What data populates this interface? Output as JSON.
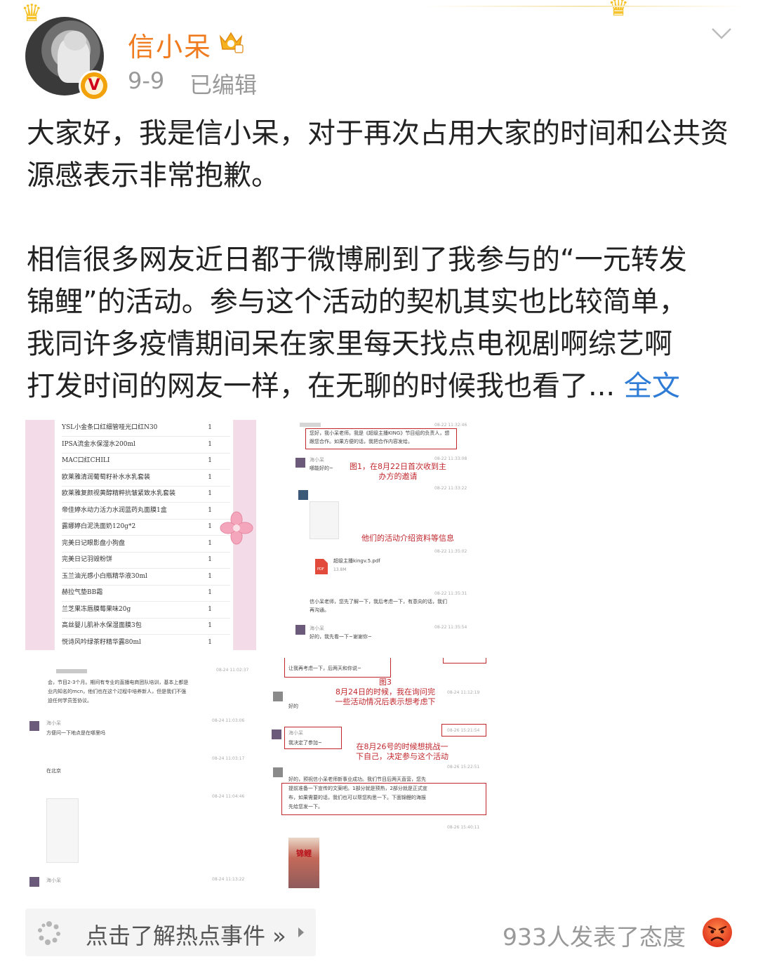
{
  "header": {
    "username": "信小呆",
    "date": "9-9",
    "edited": "已编辑",
    "verified_badge": "V",
    "icons": [
      "crown-icon",
      "vip-crown-icon",
      "verified-badge-icon",
      "chevron-down-icon"
    ]
  },
  "post": {
    "para1": "大家好，我是信小呆，对于再次占用大家的时间和公共资源感表示非常抱歉。",
    "para2_line1": "相信很多网友近日都于微博刷到了我参与的“一元转发",
    "para2_line2": "锦鲤”的活动。参与这个活动的契机其实也比较简单，",
    "para2_line3": "我同许多疫情期间呆在家里每天找点电视剧啊综艺啊",
    "para2_line4": "打发时间的网友一样，在无聊的时候我也看了...",
    "full_text_link": "全文"
  },
  "images": {
    "pic1_rows": [
      {
        "name": "YSL小金条口红细管哑光口红N30",
        "qty": "1"
      },
      {
        "name": "IPSA流金水保湿水200ml",
        "qty": "1"
      },
      {
        "name": "MAC口红CHILI",
        "qty": "1"
      },
      {
        "name": "欧莱雅清润葡萄籽补水水乳套装",
        "qty": "1"
      },
      {
        "name": "欧莱雅复颜视黄醇精粹抗皱紧致水乳套装",
        "qty": "1"
      },
      {
        "name": "帝佳婷水动力活力水润蓝药丸面膜1盒",
        "qty": "1"
      },
      {
        "name": "露娜婷白泥洗面奶120g*2",
        "qty": "1"
      },
      {
        "name": "完美日记眼影盘小狗盘",
        "qty": "1"
      },
      {
        "name": "完美日记羽毁粉饼",
        "qty": "1"
      },
      {
        "name": "玉兰油光感小白瓶精华液30ml",
        "qty": "1"
      },
      {
        "name": "赫拉气垫BB霜",
        "qty": "1"
      },
      {
        "name": "兰芝果冻唇膜莓果味20g",
        "qty": "1"
      },
      {
        "name": "高丝婴儿肌补水保湿面膜3包",
        "qty": "1"
      },
      {
        "name": "悦诗风吟绿茶籽精华露80ml",
        "qty": "1"
      }
    ],
    "pic2": {
      "msg1": "您好，我小呆老师。我是《超级主播KING》节目组的负责人，想",
      "msg1b": "跟您合作。如果方便的话，我把合作内容发给。",
      "sender": "海小呆",
      "reply1": "哪能好的~",
      "note1_line1": "图1，在8月22日首次收到主",
      "note1_line2": "办方的邀请",
      "note2": "他们的活动介绍资料等信息",
      "file_name": "超级主播kingv.5.pdf",
      "file_size": "13.8M",
      "msg2": "信小呆老师，您先了解一下，我后考虑一下，有意向的话，我们",
      "msg2b": "再沟通。",
      "reply2": "好的，我先看一下~谢谢你~",
      "time1": "08-22 11:32:46",
      "time2": "08-22 11:33:08",
      "time3": "08-22 11:33:22",
      "time4": "08-22 11:35:02",
      "time5": "08-22 11:35:31",
      "time6": "08-22 11:35:54"
    },
    "pic3": {
      "msg1": "会，节目2-3个月。期间有专业的直播电商团队培训，基本上都是",
      "msg1b": "业内知名的mcn，他们也在这个过程中培养新人，但是我们不强",
      "msg1c": "迫任何学员签协议。",
      "sender": "海小呆",
      "q1": "方便问一下地点是在哪里吗",
      "a1": "在北京",
      "time1": "08-24 11:02:37",
      "time2": "08-24 11:03:06",
      "time3": "08-24 11:03:17",
      "time4": "08-24 11:04:46",
      "time5": "08-24 11:13:22"
    },
    "pic4": {
      "top_msg": "让我再考虑一下，后两天和你说~",
      "note3_title": "图3",
      "note3_line1": "8月24日的时候，我在询问完",
      "note3_line2": "一些活动情况后表示想考虑下",
      "ok": "好的",
      "sender": "海小呆",
      "decide": "我决定了参加~",
      "note4_line1": "在8月26号的时候想挑战一",
      "note4_line2": "下自己，决定参与这个活动",
      "long1": "好的，预祝信小呆老师新事业成功。我们节目后两天直营，您先",
      "long2": "提前准备一下宣传的文案吧。1部分就是预热，2部分就是正式宣",
      "long3": "布，如果需要的话，我们也可以帮您构思一下。下面锦鲤的海报",
      "long4": "先给您发一下。",
      "poster_title": "锦鲤",
      "time1": "08-24 11:12:19",
      "time2": "08-26 15:21:54",
      "time3": "08-26 15:22:51",
      "time4": "08-26 15:40:11"
    }
  },
  "footer": {
    "hot_event_label": "点击了解热点事件 »",
    "attitude_text": "933人发表了态度"
  },
  "colors": {
    "username": "#f07b1f",
    "link": "#2e7cd6",
    "meta": "#999999",
    "annotation_red": "#c0282e"
  }
}
